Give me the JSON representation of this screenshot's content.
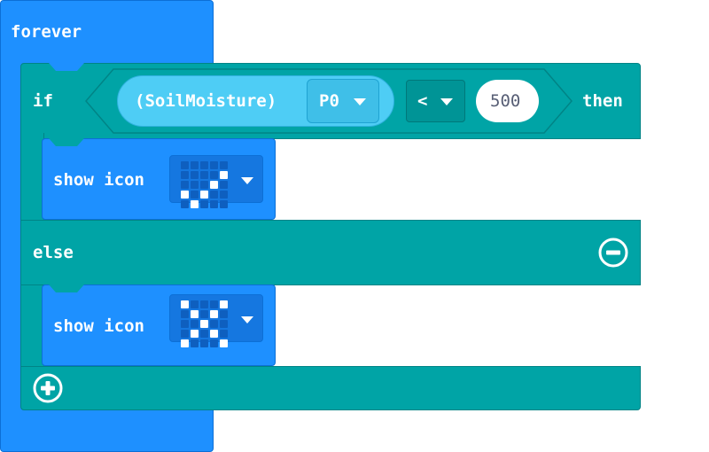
{
  "forever": {
    "label": "forever"
  },
  "if_block": {
    "if_label": "if",
    "then_label": "then",
    "else_label": "else",
    "condition": {
      "sensor_label": "(SoilMoisture)",
      "pin_value": "P0",
      "operator": "<",
      "value": "500"
    }
  },
  "show_icon_1": {
    "label": "show icon",
    "leds": [
      0,
      0,
      0,
      0,
      0,
      0,
      0,
      0,
      0,
      1,
      0,
      0,
      0,
      1,
      0,
      1,
      0,
      1,
      0,
      0,
      0,
      1,
      0,
      0,
      0
    ]
  },
  "show_icon_2": {
    "label": "show icon",
    "leds": [
      1,
      0,
      0,
      0,
      1,
      0,
      1,
      0,
      1,
      0,
      0,
      0,
      1,
      0,
      0,
      0,
      1,
      0,
      1,
      0,
      1,
      0,
      0,
      0,
      1
    ]
  },
  "colors": {
    "forever_blue": "#1e90ff",
    "logic_teal": "#00a4a6",
    "sensor_cyan": "#4ecdf5"
  },
  "icons": {
    "remove": "minus-circle-icon",
    "add": "plus-circle-icon",
    "dropdown": "caret-down-icon"
  }
}
